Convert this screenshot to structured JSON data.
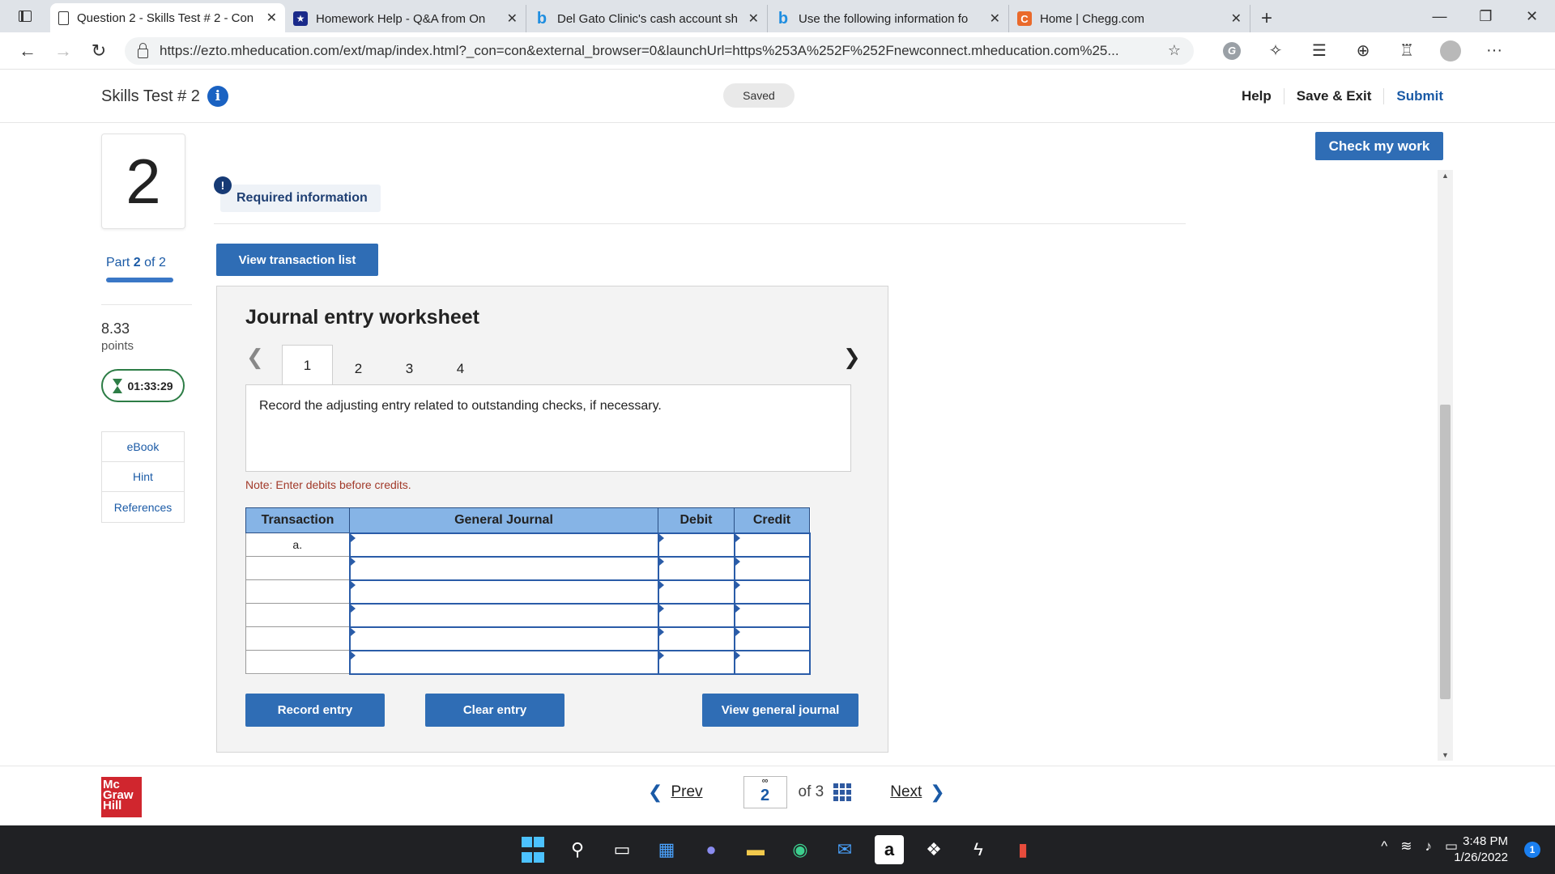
{
  "browser": {
    "tabs": [
      {
        "icon": "page-icon",
        "title": "Question 2 - Skills Test # 2 - Con",
        "active": true
      },
      {
        "icon": "homework-help-icon",
        "title": "Homework Help - Q&A from On",
        "active": false
      },
      {
        "icon": "bing-icon",
        "title": "Del Gato Clinic's cash account sh",
        "active": false
      },
      {
        "icon": "bing-icon",
        "title": "Use the following information fo",
        "active": false
      },
      {
        "icon": "chegg-icon",
        "title": "Home | Chegg.com",
        "active": false
      }
    ],
    "url": "https://ezto.mheducation.com/ext/map/index.html?_con=con&external_browser=0&launchUrl=https%253A%252F%252Fnewconnect.mheducation.com%25..."
  },
  "header": {
    "title": "Skills Test # 2",
    "status": "Saved",
    "links": [
      "Help",
      "Save & Exit",
      "Submit"
    ],
    "check_my_work": "Check my work"
  },
  "sidebar": {
    "question_number": "2",
    "part_label": "Part",
    "part_current": "2",
    "part_total": "of 2",
    "part_progress": 1.0,
    "points_value": "8.33",
    "points_label": "points",
    "timer": "01:33:29",
    "resources": [
      "eBook",
      "Hint",
      "References"
    ]
  },
  "main": {
    "required_info": "Required information",
    "view_transaction_list": "View transaction list",
    "worksheet": {
      "title": "Journal entry worksheet",
      "tabs": [
        "1",
        "2",
        "3",
        "4"
      ],
      "active_tab": "1",
      "instruction": "Record the adjusting entry related to outstanding checks, if necessary.",
      "note": "Note: Enter debits before credits.",
      "columns": [
        "Transaction",
        "General Journal",
        "Debit",
        "Credit"
      ],
      "rows": [
        {
          "transaction": "a.",
          "journal": "",
          "debit": "",
          "credit": ""
        },
        {
          "transaction": "",
          "journal": "",
          "debit": "",
          "credit": ""
        },
        {
          "transaction": "",
          "journal": "",
          "debit": "",
          "credit": ""
        },
        {
          "transaction": "",
          "journal": "",
          "debit": "",
          "credit": ""
        },
        {
          "transaction": "",
          "journal": "",
          "debit": "",
          "credit": ""
        },
        {
          "transaction": "",
          "journal": "",
          "debit": "",
          "credit": ""
        }
      ],
      "buttons": {
        "record": "Record entry",
        "clear": "Clear entry",
        "view_journal": "View general journal"
      }
    }
  },
  "footer": {
    "logo": [
      "Mc",
      "Graw",
      "Hill"
    ],
    "prev": "Prev",
    "current_page": "2",
    "of_total": "of 3",
    "next": "Next"
  },
  "taskbar": {
    "time": "3:48 PM",
    "date": "1/26/2022",
    "notifications": "1"
  }
}
